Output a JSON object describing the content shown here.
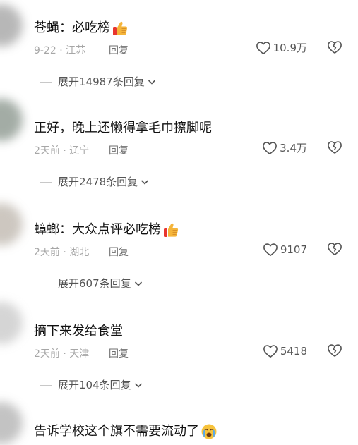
{
  "comments": [
    {
      "text": "苍蝇：必吃榜",
      "emoji": "thumbs-up",
      "meta": "9-22 · 江苏",
      "reply": "回复",
      "likes": "10.9万",
      "expand": "展开14987条回复"
    },
    {
      "text": "正好，晚上还懒得拿毛巾擦脚呢",
      "emoji": "",
      "meta": "2天前 · 辽宁",
      "reply": "回复",
      "likes": "3.4万",
      "expand": "展开2478条回复"
    },
    {
      "text": "蟑螂：大众点评必吃榜",
      "emoji": "thumbs-up",
      "meta": "2天前 · 湖北",
      "reply": "回复",
      "likes": "9107",
      "expand": "展开607条回复"
    },
    {
      "text": "摘下来发给食堂",
      "emoji": "",
      "meta": "2天前 · 天津",
      "reply": "回复",
      "likes": "5418",
      "expand": "展开104条回复"
    },
    {
      "text": "告诉学校这个旗不需要流动了",
      "emoji": "crying-face"
    }
  ]
}
